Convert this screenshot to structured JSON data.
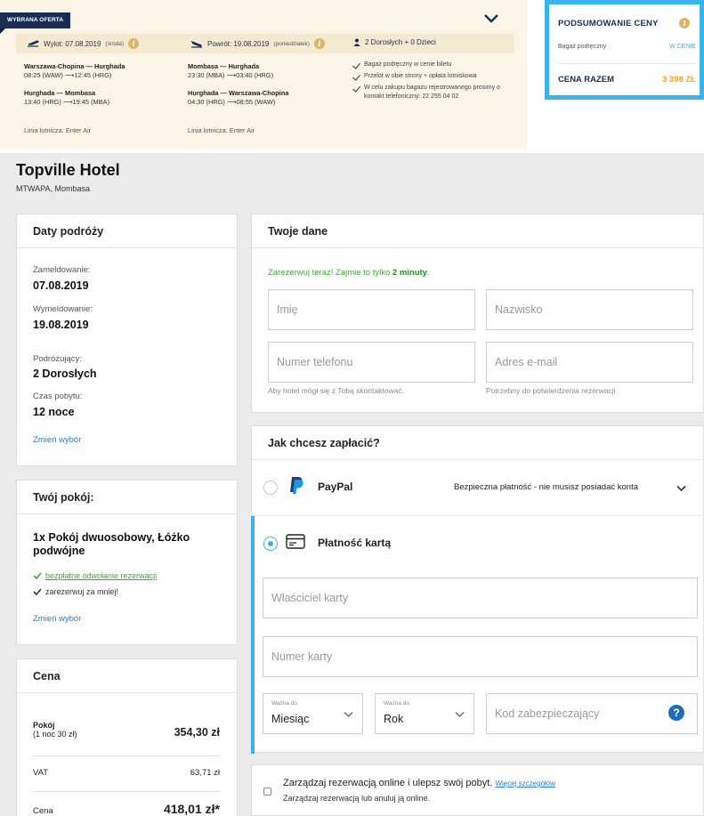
{
  "offer": {
    "ribbon": "WYBRANA OFERTA",
    "outbound": {
      "label": "Wylot: 07.08.2019",
      "day": "(środa)"
    },
    "return": {
      "label": "Powrót: 19.08.2019",
      "day": "(poniedziałek)"
    },
    "travellers": "2 Dorosłych + 0 Dzieci",
    "out_leg1_route": "Warszawa-Chopina — Hurghada",
    "out_leg1_time": "08:25 (WAW) ⟶12:45 (HRG)",
    "out_leg2_route": "Hurghada — Mombasa",
    "out_leg2_time": "13:40 (HRG) ⟶19:45 (MBA)",
    "out_airline": "Linia lotnicza: Enter Air",
    "ret_leg1_route": "Mombasa — Hurghada",
    "ret_leg1_time": "23:30 (MBA) ⟶03:40 (HRG)",
    "ret_leg2_route": "Hurghada — Warszawa-Chopina",
    "ret_leg2_time": "04:30 (HRG) ⟶08:55 (WAW)",
    "ret_airline": "Linia lotnicza: Enter Air",
    "notes": [
      "Bagaż podręczny w cenie biletu",
      "Przelot w obie strony + opłata lotniskowa",
      "W celu zakupu bagażu rejestrowanego prosimy o kontakt telefoniczny: 22 255 04 02"
    ]
  },
  "summary": {
    "title": "PODSUMOWANIE CENY",
    "baggage_label": "Bagaż podręczny",
    "baggage_value": "W CENIE",
    "total_label": "CENA RAZEM",
    "total_value": "3 398 ZŁ"
  },
  "hotel": {
    "name": "Topville Hotel",
    "location": "MTWAPA, Mombasa"
  },
  "travel_dates": {
    "title": "Daty podróży",
    "checkin_label": "Zameldowanie:",
    "checkin_value": "07.08.2019",
    "checkout_label": "Wymeldowanie:",
    "checkout_value": "19.08.2019",
    "travellers_label": "Podróżujący:",
    "travellers_value": "2 Dorosłych",
    "stay_label": "Czas pobytu:",
    "stay_value": "12 noce",
    "change_link": "Zmień wybór"
  },
  "room": {
    "title": "Twój pokój:",
    "description": "1x Pokój dwuosobowy, Łóżko podwójne",
    "free_cancel": "bezpłatne odwołanie rezerwacji",
    "reserve_for_me": "zarezerwuj za mniej!",
    "change_link": "Zmień wybór"
  },
  "price": {
    "title": "Cena",
    "room_label": "Pokój",
    "room_sub": "(1 noc 30 zł)",
    "room_value": "354,30 zł",
    "vat_label": "VAT",
    "vat_value": "63,71 zł",
    "total_label": "Cena",
    "total_value": "418,01 zł*"
  },
  "your_data": {
    "title": "Twoje dane",
    "promo_text": "Zarezerwuj teraz! Zajmie to tylko",
    "promo_bold": "2 minuty",
    "promo_end": ".",
    "first_name_ph": "Imię",
    "last_name_ph": "Nazwisko",
    "phone_ph": "Numer telefonu",
    "email_ph": "Adres e-mail",
    "phone_hint": "Aby hotel mógł się z Tobą skontaktować.",
    "email_hint": "Potrzebny do potwierdzenia rezerwacji"
  },
  "payment": {
    "title": "Jak chcesz zapłacić?",
    "paypal_label": "PayPal",
    "paypal_note": "Bezpieczna płatność - nie musisz posiadać konta",
    "card_label": "Płatność kartą",
    "card_owner_ph": "Właściciel karty",
    "card_number_ph": "Numer karty",
    "month_caption": "Ważna do",
    "month_value": "Miesiąc",
    "year_caption": "Ważna do",
    "year_value": "Rok",
    "cvc_ph": "Kod zabezpieczający",
    "help_glyph": "?"
  },
  "manage": {
    "title": "Zarządzaj rezerwacją online i ulepsz swój pobyt.",
    "link": "Więcej szczegółów",
    "sub": "Zarządzaj rezerwacją lub anuluj ją online."
  },
  "colors": {
    "accent": "#3ab4e8",
    "navy": "#1c2d55",
    "orange": "#f5a623",
    "green": "#3fa63a"
  }
}
